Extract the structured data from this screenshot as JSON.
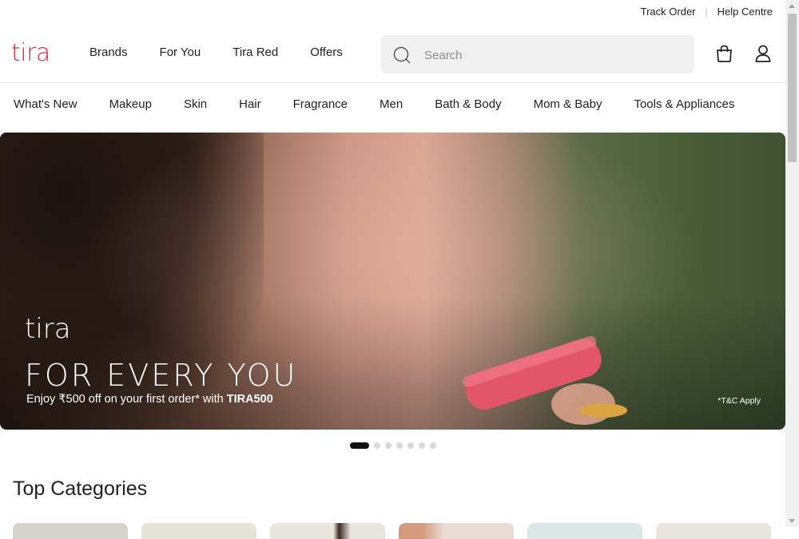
{
  "topbar": {
    "track_order": "Track Order",
    "help_centre": "Help Centre"
  },
  "header": {
    "logo": "tira",
    "nav": [
      "Brands",
      "For You",
      "Tira Red",
      "Offers"
    ],
    "search": {
      "placeholder": "Search",
      "value": ""
    },
    "icons": [
      "search-icon",
      "bag-icon",
      "user-icon"
    ]
  },
  "categories": [
    "What's New",
    "Makeup",
    "Skin",
    "Hair",
    "Fragrance",
    "Men",
    "Bath & Body",
    "Mom & Baby",
    "Tools & Appliances"
  ],
  "hero": {
    "brand": "tira",
    "title": "FOR EVERY YOU",
    "subtitle_prefix": "Enjoy ₹500 off on your first order* with ",
    "subtitle_code": "TIRA500",
    "terms": "*T&C Apply"
  },
  "carousel": {
    "slides": 7,
    "active_index": 0
  },
  "sections": {
    "top_categories": "Top Categories"
  },
  "colors": {
    "brand": "#e0262e",
    "text": "#222222",
    "search_bg": "#f1f1f1"
  }
}
